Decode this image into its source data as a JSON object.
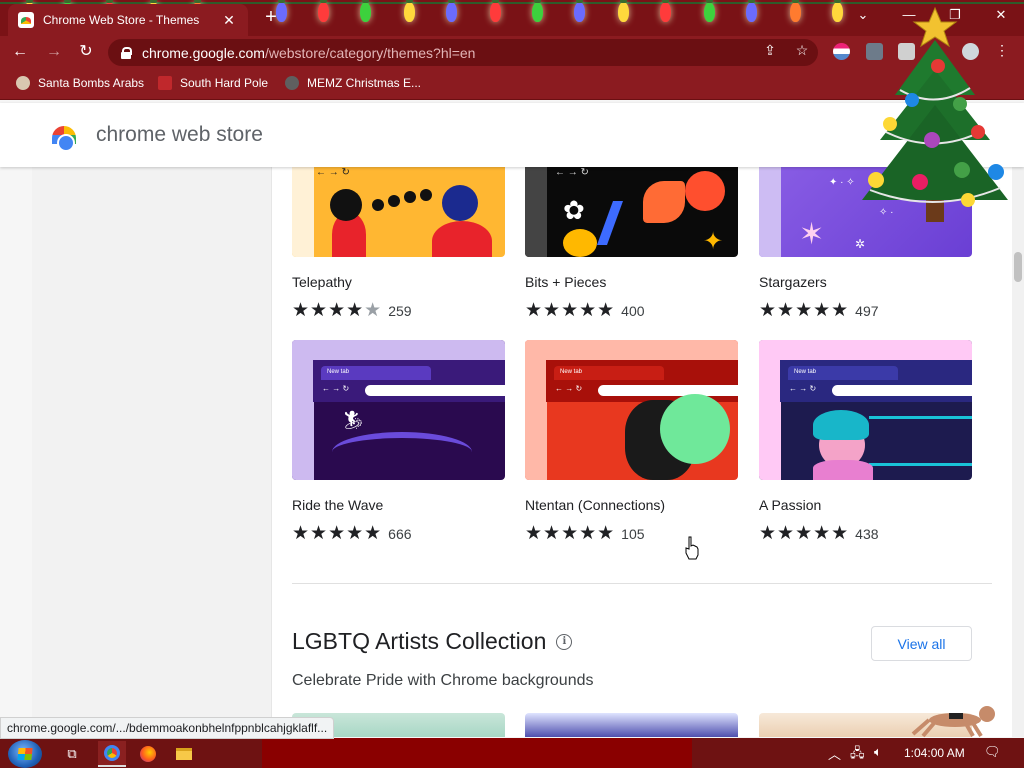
{
  "browser": {
    "tab_title": "Chrome Web Store - Themes",
    "tab_close": "✕",
    "new_tab": "+",
    "url_host": "chrome.google.com",
    "url_path": "/webstore/category/themes?hl=en",
    "window_minimize": "—",
    "window_restore": "❐",
    "window_close": "✕",
    "tabs_dropdown": "⌄"
  },
  "bookmarks": [
    {
      "label": "Santa Bombs Arabs",
      "icon": "bookmark-user-icon"
    },
    {
      "label": "South Hard Pole",
      "icon": "bookmark-snowflake-icon"
    },
    {
      "label": "MEMZ Christmas E...",
      "icon": "bookmark-globe-icon"
    }
  ],
  "store": {
    "name": "chrome web store"
  },
  "themes": [
    {
      "name": "Telepathy",
      "count": "259",
      "rating": 4,
      "colors": [
        "#ffb732",
        "#fff1d6"
      ]
    },
    {
      "name": "Bits + Pieces",
      "count": "400",
      "rating": 4.5,
      "colors": [
        "#0a0a0a",
        "#ff6b35"
      ]
    },
    {
      "name": "Stargazers",
      "count": "497",
      "rating": 4.5,
      "colors": [
        "#7b4fe0",
        "#b48df0"
      ]
    },
    {
      "name": "Ride the Wave",
      "count": "666",
      "rating": 4.5,
      "colors": [
        "#2a0a4f",
        "#cdbaf0"
      ]
    },
    {
      "name": "Ntentan (Connections)",
      "count": "105",
      "rating": 4.5,
      "colors": [
        "#e8381f",
        "#ffb8a8"
      ]
    },
    {
      "name": "A Passion",
      "count": "438",
      "rating": 5,
      "colors": [
        "#1d1b4f",
        "#ffc9f5"
      ]
    }
  ],
  "section": {
    "title": "LGBTQ Artists Collection",
    "subtitle": "Celebrate Pride with Chrome backgrounds",
    "view_all": "View all"
  },
  "status_url": "chrome.google.com/.../bdemmoakonbhelnfppnblcahjgklaflf...",
  "taskbar": {
    "time": "1:04:00 AM"
  },
  "colors": {
    "browser_frame": "#8b1b20",
    "titlebar": "#7a1216",
    "taskbar": "#6e1212",
    "link_blue": "#1a73e8"
  }
}
